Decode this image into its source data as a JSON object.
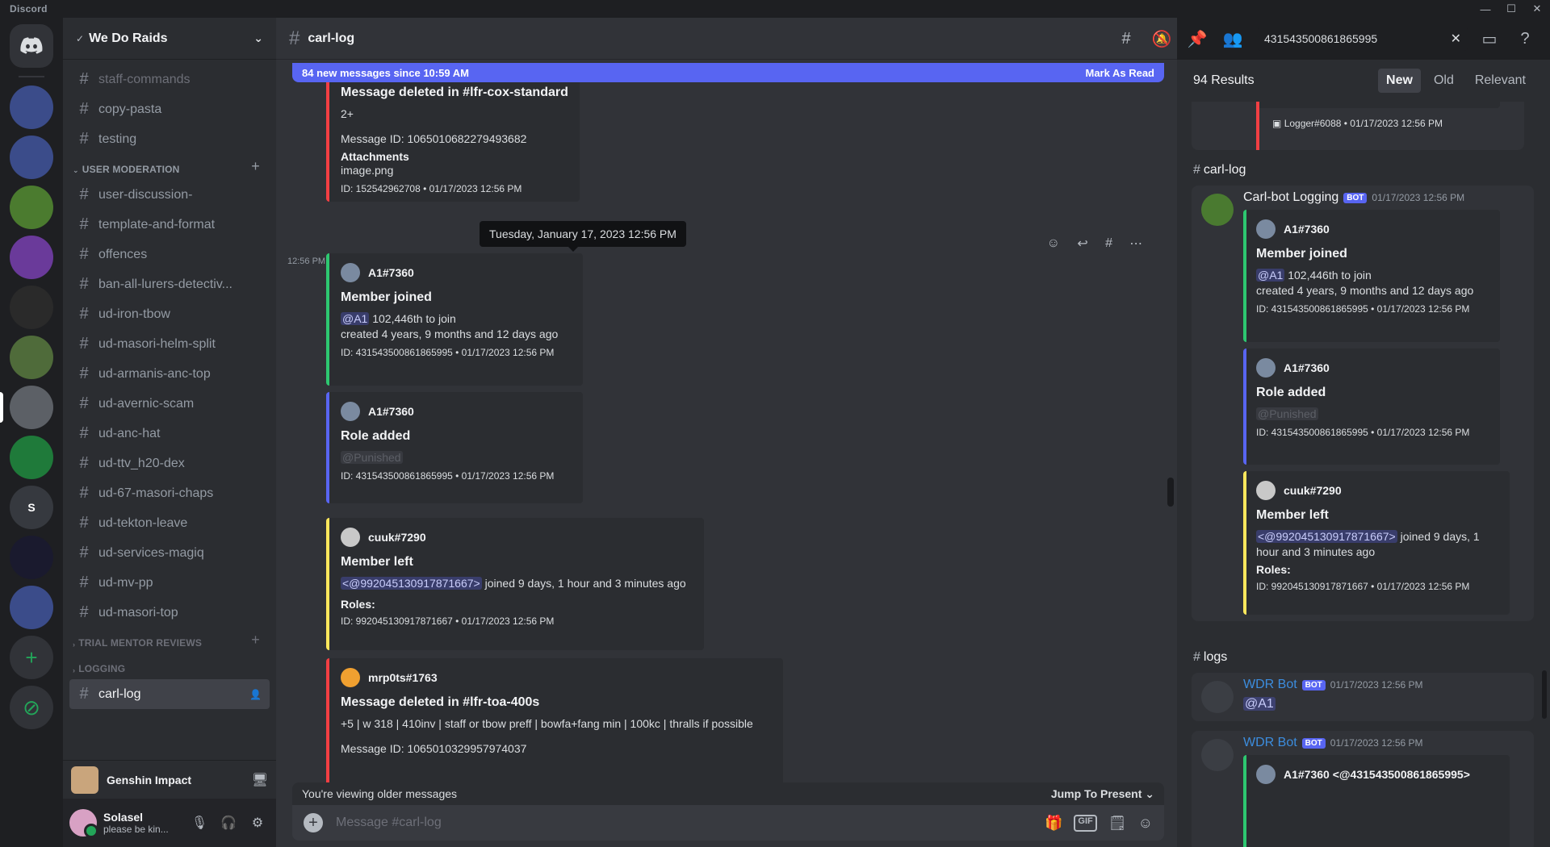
{
  "app": {
    "title": "Discord"
  },
  "window": {
    "minimize": "—",
    "maximize": "☐",
    "close": "✕"
  },
  "rail": {
    "home_label": "Discord home",
    "servers": [
      "",
      "",
      "",
      "",
      "",
      "",
      "",
      "",
      "",
      "",
      "S",
      "",
      ""
    ],
    "add_label": "+",
    "explore_label": "⊘"
  },
  "guild": {
    "name": "We Do Raids",
    "verified": "✓"
  },
  "sidebar": {
    "channels_top": [
      "staff-commands",
      "copy-pasta",
      "testing"
    ],
    "category_user_moderation": "USER MODERATION",
    "channels_user_moderation": [
      "user-discussion-",
      "template-and-format",
      "offences",
      "ban-all-lurers-detectiv...",
      "ud-iron-tbow",
      "ud-masori-helm-split",
      "ud-armanis-anc-top",
      "ud-avernic-scam",
      "ud-anc-hat",
      "ud-ttv_h20-dex",
      "ud-67-masori-chaps",
      "ud-tekton-leave",
      "ud-services-magiq",
      "ud-mv-pp",
      "ud-masori-top"
    ],
    "category_trial": "TRIAL MENTOR REVIEWS",
    "category_logging": "LOGGING",
    "selected_channel": "carl-log"
  },
  "activity": {
    "name": "Genshin Impact"
  },
  "user": {
    "name": "Solasel",
    "status": "please be kin..."
  },
  "chat": {
    "channel": "carl-log",
    "new_messages": "84 new messages since 10:59 AM",
    "mark_as_read": "Mark As Read",
    "tooltip": "Tuesday, January 17, 2023 12:56 PM",
    "gutter_time": "12:56 PM",
    "viewing_older": "You're viewing older messages",
    "jump_to_present": "Jump To Present",
    "composer_placeholder": "Message #carl-log",
    "embeds": [
      {
        "title": "Message deleted in #lfr-cox-standard",
        "content": "2+",
        "message_id": "Message ID: 1065010682279493682",
        "field_name": "Attachments",
        "field_value": "image.png",
        "footer": "ID: 152542962708 • 01/17/2023 12:56 PM"
      },
      {
        "author": "A1#7360",
        "title": "Member joined",
        "mention": "@A1",
        "line1": "102,446th to join",
        "line2": "created 4 years, 9 months and 12 days ago",
        "footer": "ID: 431543500861865995 • 01/17/2023 12:56 PM"
      },
      {
        "author": "A1#7360",
        "title": "Role added",
        "role": "@Punished",
        "footer": "ID: 431543500861865995 • 01/17/2023 12:56 PM"
      },
      {
        "author": "cuuk#7290",
        "title": "Member left",
        "mention": "<@992045130917871667>",
        "line1": "joined 9 days, 1 hour and 3 minutes ago",
        "field_name": "Roles:",
        "footer": "ID: 992045130917871667 • 01/17/2023 12:56 PM"
      },
      {
        "author": "mrp0ts#1763",
        "title": "Message deleted in #lfr-toa-400s",
        "content": "+5 | w 318 | 410inv | staff or tbow preff | bowfa+fang min | 100kc | thralls if possible",
        "message_id": "Message ID: 1065010329957974037"
      }
    ]
  },
  "search": {
    "query": "431543500861865995",
    "clear": "✕"
  },
  "results": {
    "count": "94 Results",
    "tabs": [
      "New",
      "Old",
      "Relevant"
    ],
    "top_footer": "Logger#6088 • 01/17/2023 12:56 PM",
    "group1_channel": "carl-log",
    "group1_author": "Carl-bot Logging",
    "group1_time": "01/17/2023 12:56 PM",
    "bot_tag": "BOT",
    "e1": {
      "author": "A1#7360",
      "title": "Member joined",
      "mention": "@A1",
      "line1": "102,446th to join",
      "line2": "created 4 years, 9 months and 12 days ago",
      "footer": "ID: 431543500861865995 • 01/17/2023 12:56 PM"
    },
    "e2": {
      "author": "A1#7360",
      "title": "Role added",
      "role": "@Punished",
      "footer": "ID: 431543500861865995 • 01/17/2023 12:56 PM"
    },
    "e3": {
      "author": "cuuk#7290",
      "title": "Member left",
      "mention": "<@992045130917871667>",
      "line1": "joined 9 days, 1",
      "line2": "hour and 3 minutes ago",
      "field_name": "Roles:",
      "footer": "ID: 992045130917871667 • 01/17/2023 12:56 PM"
    },
    "group2_channel": "logs",
    "g2_m1_author": "WDR Bot",
    "g2_m1_time": "01/17/2023 12:56 PM",
    "g2_m1_mention": "@A1",
    "g2_m2_author": "WDR Bot",
    "g2_m2_time": "01/17/2023 12:56 PM",
    "g2_m2_embed_author": "A1#7360 <@431543500861865995>"
  }
}
